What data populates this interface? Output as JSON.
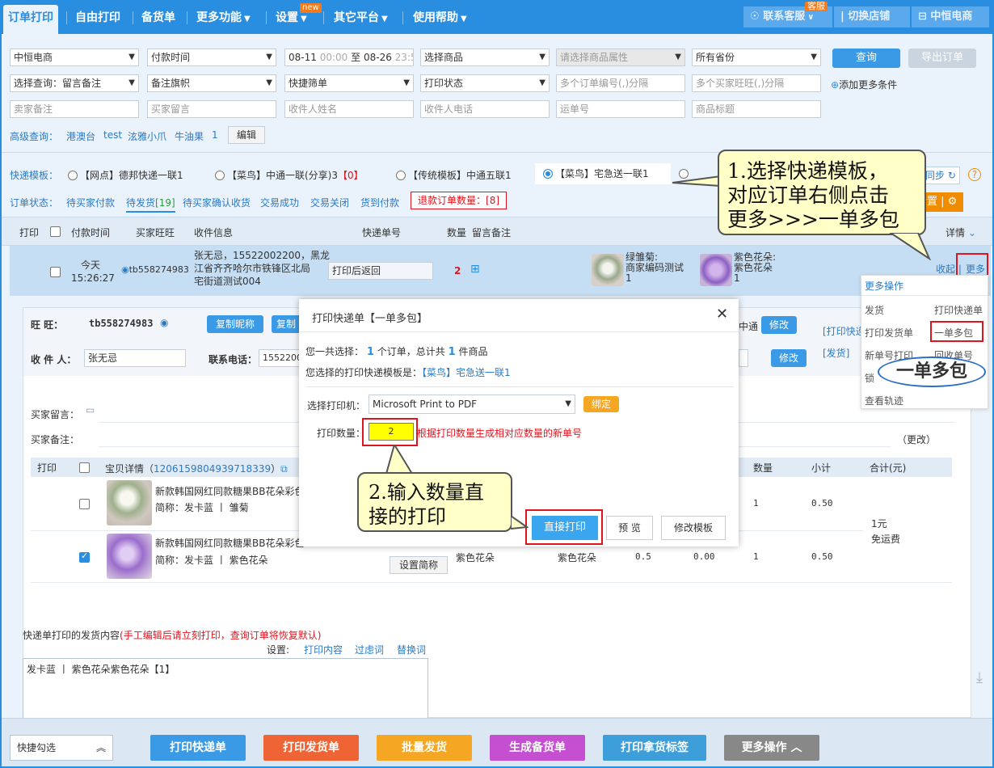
{
  "nav": {
    "tabs": [
      "订单打印",
      "自由打印",
      "备货单",
      "更多功能",
      "设置",
      "其它平台",
      "使用帮助"
    ],
    "new_badge": "new",
    "service": "联系客服",
    "service_badge": "客服",
    "switch_shop": "切换店铺",
    "shop_name": "中恒电商"
  },
  "filters": {
    "row1": {
      "shop": "中恒电商",
      "time_type": "付款时间",
      "date_from": "08-11",
      "time_from": "00:00",
      "date_to_label": "至",
      "date_to": "08-26",
      "time_to": "23:59",
      "goods": "选择商品",
      "goods_attr": "请选择商品属性",
      "province": "所有省份",
      "query": "查询",
      "export": "导出订单"
    },
    "row2": {
      "query_type": "选择查询：留言备注",
      "flag": "备注旗帜",
      "quick": "快捷筛单",
      "print_status": "打印状态",
      "order_ids": "多个订单编号(,)分隔",
      "buyer_ids": "多个买家旺旺(,)分隔",
      "add_more": "添加更多条件"
    },
    "row3": {
      "seller_note": "卖家备注",
      "buyer_msg": "买家留言",
      "receiver_name": "收件人姓名",
      "receiver_phone": "收件人电话",
      "waybill": "运单号",
      "goods_title": "商品标题"
    },
    "advanced": {
      "label": "高级查询：",
      "items": [
        "港澳台",
        "test",
        "泫雅小爪",
        "牛油果",
        "1"
      ],
      "edit": "编辑"
    }
  },
  "templates": {
    "label": "快递模板：",
    "items": [
      "【网点】德邦快递一联1",
      "【菜鸟】中通一联(分享)3",
      "【传统模板】中通五联1",
      "【菜鸟】宅急送一联1"
    ],
    "count": "【0】",
    "sync": "同步",
    "set": "设置"
  },
  "status": {
    "label": "订单状态：",
    "items": [
      "待买家付款",
      "待发货",
      "待买家确认收货",
      "交易成功",
      "交易关闭",
      "货到付款"
    ],
    "pending_count": "[19]",
    "refund_label": "退款订单数量：",
    "refund_count": "[8]"
  },
  "table": {
    "headers": [
      "打印",
      "付款时间",
      "买家旺旺",
      "收件信息",
      "快递单号",
      "数量",
      "留言备注",
      "详情"
    ],
    "row": {
      "date": "今天",
      "time": "15:26:27",
      "buyer": "tb558274983",
      "receiver": [
        "张无忌，15522002200，黑龙",
        "江省齐齐哈尔市铁锋区北局",
        "宅街道测试004"
      ],
      "waybill_status": "打印后返回",
      "qty": "2",
      "item1_name": "绿雏菊:",
      "item1_code": "商家编码测试",
      "item1_qty": "1",
      "item2_name": "紫色花朵:",
      "item2_code": "紫色花朵",
      "item2_qty": "1",
      "collapse": "收起",
      "more": "更多"
    }
  },
  "detail": {
    "wangwang_label": "旺    旺：",
    "wangwang": "tb558274983",
    "copy_nick": "复制昵称",
    "copy2": "复制",
    "receiver_label": "收 件 人：",
    "receiver": "张无忌",
    "phone_label": "联系电话：",
    "phone": "15522002",
    "tongtong": "中通",
    "modify": "修改",
    "print_express": "[打印快递",
    "ship": "[发货]",
    "buyer_msg_label": "买家留言：",
    "seller_note_label": "买家备注：",
    "change": "（更改）",
    "goods_headers": [
      "打印",
      "宝贝详情",
      "数量",
      "小计",
      "合计(元)"
    ],
    "order_no": "1206159804939718339",
    "goods": [
      {
        "title": "新款韩国网红同款糖果BB花朵彩色",
        "short_label": "简称：",
        "short": "发卡蓝",
        "sku": "雏菊",
        "qty": "1",
        "subtotal": "0.50"
      },
      {
        "title": "新款韩国网红同款糖果BB花朵彩色",
        "short_label": "简称：",
        "short": "发卡蓝",
        "sku": "紫色花朵",
        "col_a": "紫色花朵",
        "col_b": "紫色花朵",
        "price": "0.5",
        "discount": "0.00",
        "qty": "1",
        "subtotal": "0.50"
      }
    ],
    "total": "1元",
    "free_ship": "免运费",
    "set_short": "设置简称",
    "ship_content_label": "快递单打印的发货内容",
    "ship_content_note": "(手工编辑后请立刻打印，查询订单将恢复默认)",
    "settings_label": "设置:",
    "settings": [
      "打印内容",
      "过虑词",
      "替换词"
    ],
    "ship_content": "发卡蓝 丨 紫色花朵紫色花朵【1】"
  },
  "menu": {
    "title": "更多操作",
    "items": [
      [
        "发货",
        "打印快递单"
      ],
      [
        "打印发货单",
        "一单多包"
      ],
      [
        "新单号打印",
        "回收单号"
      ],
      [
        "锁",
        ""
      ],
      [
        "查看轨迹",
        ""
      ]
    ],
    "bubble": "一单多包"
  },
  "modal": {
    "title": "打印快递单【一单多包】",
    "summary_pre": "您一共选择：",
    "orders": "1",
    "summary_mid": "个订单，总计共",
    "items": "1",
    "summary_post": "件商品",
    "template_pre": "您选择的打印快递模板是：",
    "template": "【菜鸟】宅急送一联1",
    "printer_label": "选择打印机：",
    "printer": "Microsoft Print to PDF",
    "bind": "绑定",
    "qty_label": "打印数量：",
    "qty": "2",
    "qty_hint": "根据打印数量生成相对应数量的新单号",
    "print": "直接打印",
    "preview": "预 览",
    "edit_template": "修改模板"
  },
  "callouts": {
    "c1": [
      "1.选择快递模板，",
      "对应订单右侧点击",
      "更多>>>一单多包"
    ],
    "c2": [
      "2.输入数量直",
      "接的打印"
    ]
  },
  "bottom": {
    "quick": "快捷勾选",
    "buttons": [
      "打印快递单",
      "打印发货单",
      "批量发货",
      "生成备货单",
      "打印拿货标签",
      "更多操作"
    ]
  }
}
